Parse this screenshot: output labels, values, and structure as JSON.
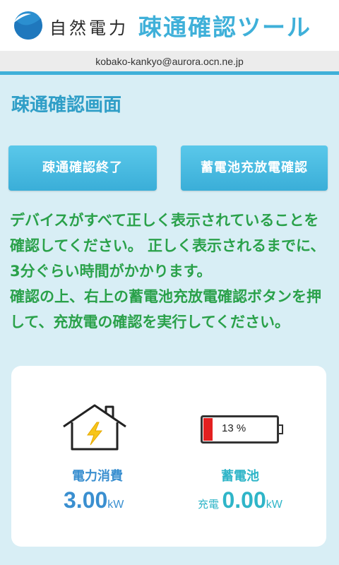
{
  "header": {
    "brand": "自然電力",
    "app_title": "疎通確認ツール",
    "accent_color": "#3fb0d9"
  },
  "account": {
    "email": "kobako-kankyo@aurora.ocn.ne.jp"
  },
  "screen": {
    "title": "疎通確認画面"
  },
  "buttons": {
    "end_check": "疎通確認終了",
    "battery_check": "蓄電池充放電確認"
  },
  "instructions": [
    "デバイスがすべて正しく表示されていることを確認してください。 正しく表示されるまでに、3分ぐらい時間がかかります。",
    "確認の上、右上の蓄電池充放電確認ボタンを押して、充放電の確認を実行してください。"
  ],
  "power": {
    "icon": "house-bolt-icon",
    "label": "電力消費",
    "value": "3.00",
    "unit": "kW"
  },
  "battery": {
    "icon": "battery-icon",
    "level_text": "13 %",
    "level_fraction": 0.13,
    "label": "蓄電池",
    "state": "充電",
    "value": "0.00",
    "unit": "kW"
  }
}
